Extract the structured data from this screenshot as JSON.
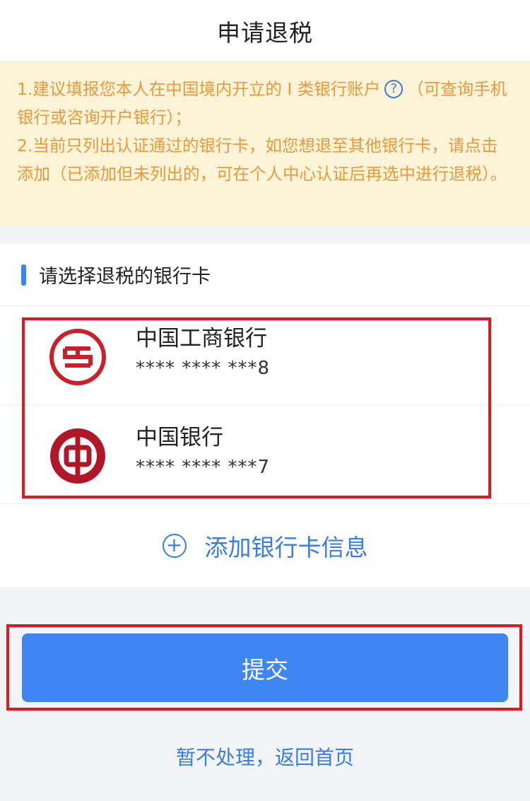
{
  "header": {
    "title": "申请退税"
  },
  "notice": {
    "line1_before_icon": "1.建议填报您本人在中国境内开立的 I 类银行账户",
    "help_icon": "?",
    "line1_after_icon": "（可查询手机银行或咨询开户银行）；",
    "line2": "2.当前只列出认证通过的银行卡，如您想退至其他银行卡，请点击添加（已添加但未列出的，可在个人中心认证后再选中进行退税）。"
  },
  "section": {
    "title": "请选择退税的银行卡"
  },
  "cards": [
    {
      "bank": "中国工商银行",
      "number": "**** **** ***8",
      "logo": "icbc-logo-icon",
      "color": "#c9202a"
    },
    {
      "bank": "中国银行",
      "number": "**** **** ***7",
      "logo": "boc-logo-icon",
      "color": "#b0182a"
    }
  ],
  "add_card": {
    "icon": "plus-circle-icon",
    "symbol": "+",
    "label": "添加银行卡信息"
  },
  "submit": {
    "label": "提交"
  },
  "back": {
    "label": "暂不处理，返回首页"
  },
  "colors": {
    "accent": "#3f86f2",
    "notice_bg": "#fdf3d6",
    "notice_text": "#e89a3c",
    "highlight": "#e4161f"
  }
}
